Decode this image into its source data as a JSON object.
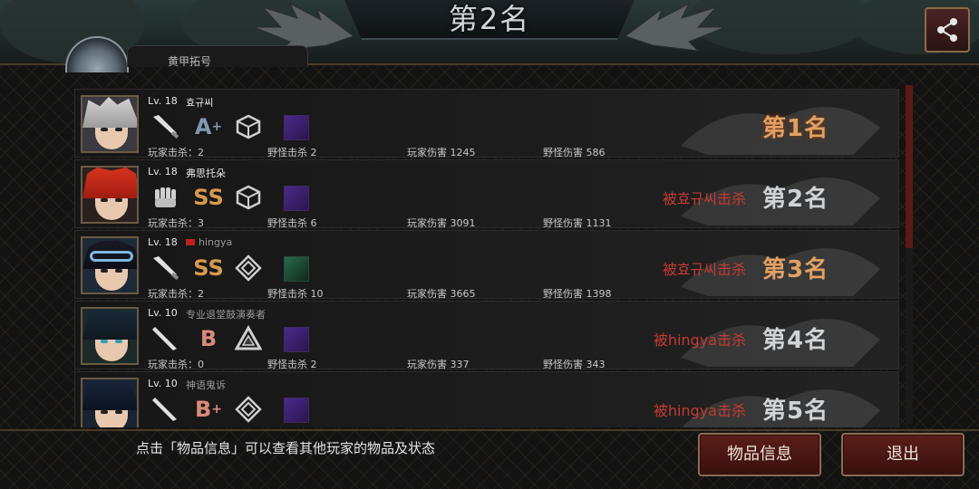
{
  "title": "第2名",
  "player_header": "黄甲拓号",
  "hint": "点击「物品信息」可以查看其他玩家的物品及状态",
  "buttons": {
    "items": "物品信息",
    "exit": "退出"
  },
  "colors": {
    "gold_rank": "#e1a064",
    "killed_by": "#c43b32",
    "button_bg": "#4a1613"
  },
  "players": [
    {
      "level": "Lv. 18",
      "name": "효규씨",
      "weapon_icon": "knife-icon",
      "grade_base": "A",
      "grade_plus": "+",
      "grade_color": "#7f97b4",
      "armor_icon": "cube-shield-icon",
      "skill_icon": "purple-skill-icon",
      "player_kills": "玩家击杀：2",
      "monster_kills": "野怪击杀 2",
      "player_damage": "玩家伤害 1245",
      "monster_damage": "野怪伤害 586",
      "killed_by": "",
      "rank": "第1名"
    },
    {
      "level": "Lv. 18",
      "name": "弗思托朵",
      "weapon_icon": "fist-icon",
      "grade_base": "SS",
      "grade_plus": "",
      "grade_color": "#d79a4c",
      "armor_icon": "cube-shield-icon",
      "skill_icon": "purple-skill-icon",
      "player_kills": "玩家击杀：3",
      "monster_kills": "野怪击杀 6",
      "player_damage": "玩家伤害 3091",
      "monster_damage": "野怪伤害 1131",
      "killed_by": "被효규씨击杀",
      "rank": "第2名"
    },
    {
      "level": "Lv. 18",
      "name": "hingya",
      "weapon_icon": "knife-icon",
      "grade_base": "SS",
      "grade_plus": "",
      "grade_color": "#d79a4c",
      "armor_icon": "diamond-shield-icon",
      "skill_icon": "green-skill-icon",
      "player_kills": "玩家击杀：2",
      "monster_kills": "野怪击杀 10",
      "player_damage": "玩家伤害 3665",
      "monster_damage": "野怪伤害 1398",
      "killed_by": "被효규씨击杀",
      "rank": "第3名"
    },
    {
      "level": "Lv. 10",
      "name": "专业退堂鼓演奏者",
      "weapon_icon": "bat-icon",
      "grade_base": "B",
      "grade_plus": "",
      "grade_color": "#d88a7a",
      "armor_icon": "triangle-shield-icon",
      "skill_icon": "purple-skill-icon",
      "player_kills": "玩家击杀：0",
      "monster_kills": "野怪击杀 2",
      "player_damage": "玩家伤害 337",
      "monster_damage": "野怪伤害 343",
      "killed_by": "被hingya击杀",
      "rank": "第4名"
    },
    {
      "level": "Lv. 10",
      "name": "神语鬼诉",
      "weapon_icon": "bat-icon",
      "grade_base": "B",
      "grade_plus": "+",
      "grade_color": "#d88a7a",
      "armor_icon": "diamond-shield-icon",
      "skill_icon": "purple-skill-icon",
      "player_kills": "",
      "monster_kills": "",
      "player_damage": "",
      "monster_damage": "",
      "killed_by": "被hingya击杀",
      "rank": "第5名"
    }
  ]
}
